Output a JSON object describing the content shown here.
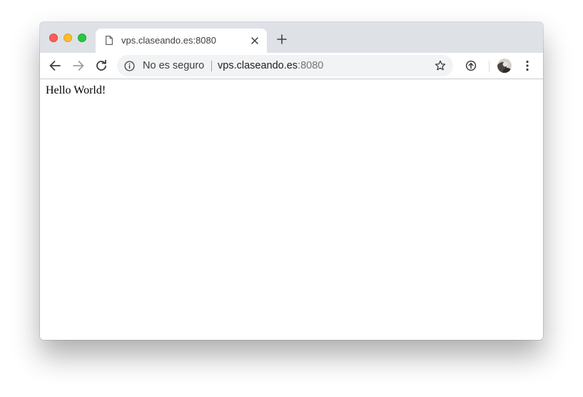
{
  "tab": {
    "title": "vps.claseando.es:8080",
    "favicon_icon": "page-icon",
    "close_icon": "close-icon"
  },
  "toolbar": {
    "back_icon": "arrow-left-icon",
    "forward_icon": "arrow-right-icon",
    "reload_icon": "reload-icon",
    "new_tab_icon": "plus-icon"
  },
  "omnibox": {
    "security_icon": "info-icon",
    "security_label": "No es seguro",
    "url_host": "vps.claseando.es",
    "url_port": ":8080",
    "bookmark_icon": "star-icon"
  },
  "extensions": {
    "extension_icon": "arrow-up-circle-icon",
    "menu_icon": "more-vertical-icon"
  },
  "page": {
    "body_text": "Hello World!"
  },
  "colors": {
    "titlebar": "#dee1e6",
    "omnibox": "#f1f3f4",
    "close_button": "#fe5f57",
    "minimize_button": "#febc2e",
    "maximize_button": "#28c840"
  }
}
